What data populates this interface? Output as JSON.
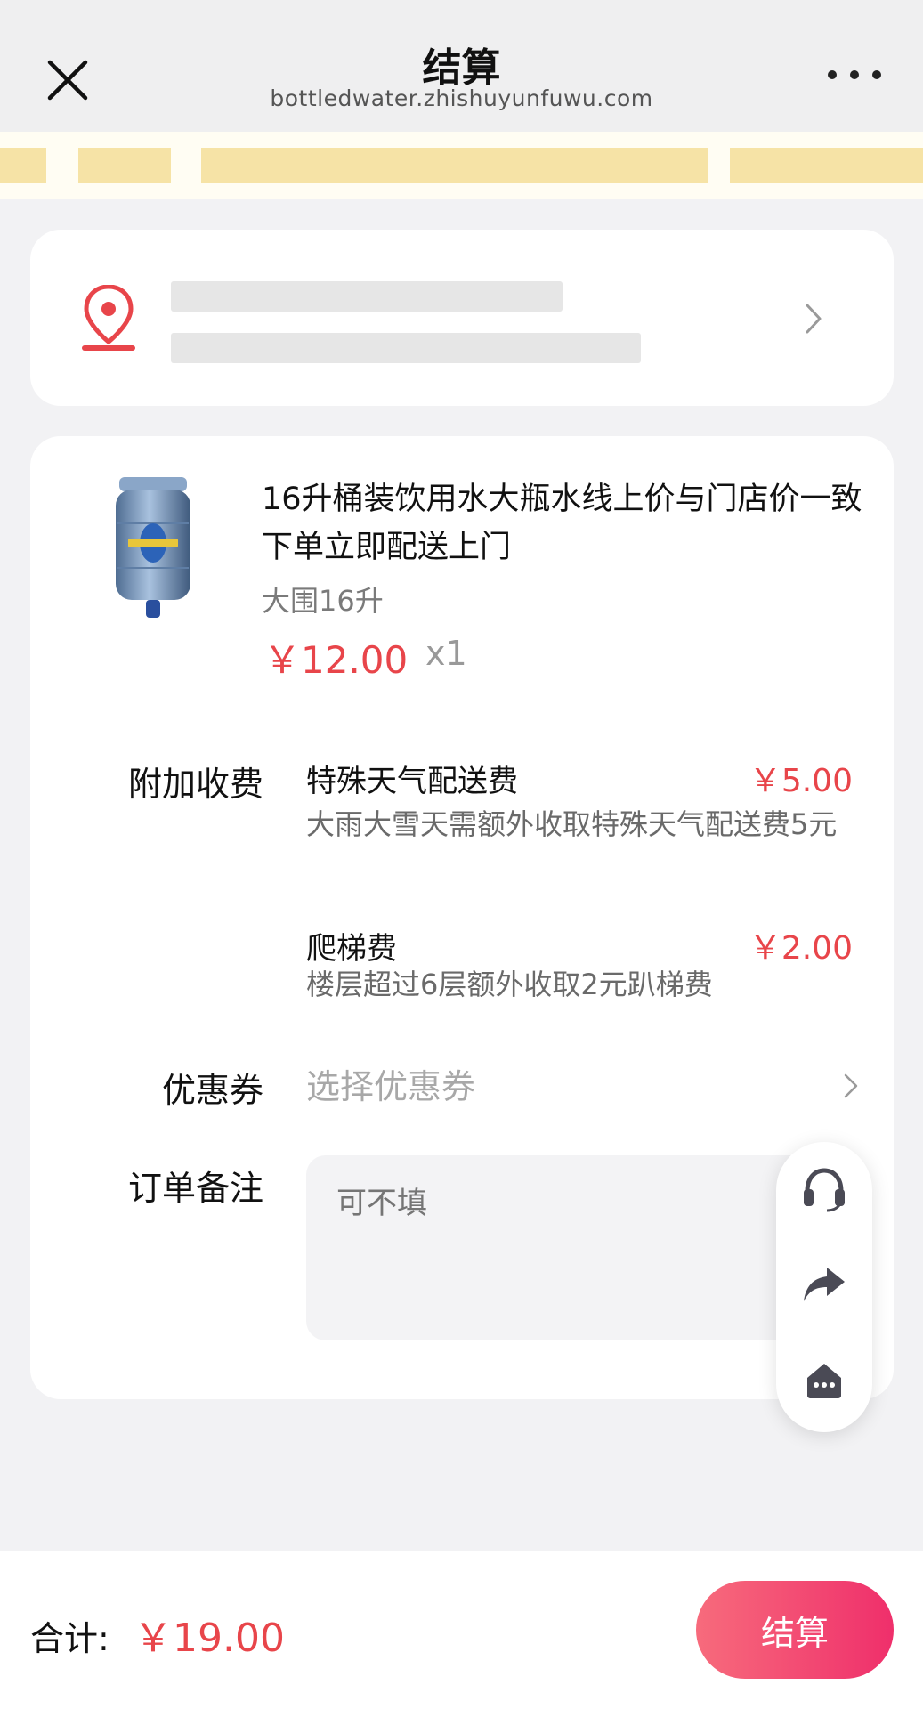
{
  "header": {
    "title": "结算",
    "url": "bottledwater.zhishuyunfuwu.com"
  },
  "product": {
    "title": "16升桶装饮用水大瓶水线上价与门店价一致下单立即配送上门",
    "spec": "大围16升",
    "price": "￥12.00",
    "quantity": "x1"
  },
  "extra_fees": {
    "label": "附加收费",
    "items": [
      {
        "name": "特殊天气配送费",
        "price": "￥5.00",
        "desc": "大雨大雪天需额外收取特殊天气配送费5元"
      },
      {
        "name": "爬梯费",
        "price": "￥2.00",
        "desc": "楼层超过6层额外收取2元趴梯费"
      }
    ]
  },
  "coupon": {
    "label": "优惠券",
    "placeholder": "选择优惠券"
  },
  "remark": {
    "label": "订单备注",
    "placeholder": "可不填"
  },
  "footer": {
    "total_label": "合计:",
    "total_value": "￥19.00",
    "submit_label": "结算"
  },
  "icons": {
    "close": "close-icon",
    "more": "more-dots-icon",
    "location": "location-pin-icon",
    "chevron": "chevron-right-icon",
    "service": "headset-icon",
    "share": "share-arrow-icon",
    "home": "home-icon"
  },
  "colors": {
    "accent_red": "#e8454a",
    "button_gradient_start": "#f76b7c",
    "button_gradient_end": "#ef2f6b",
    "page_background": "#f2f2f4"
  }
}
